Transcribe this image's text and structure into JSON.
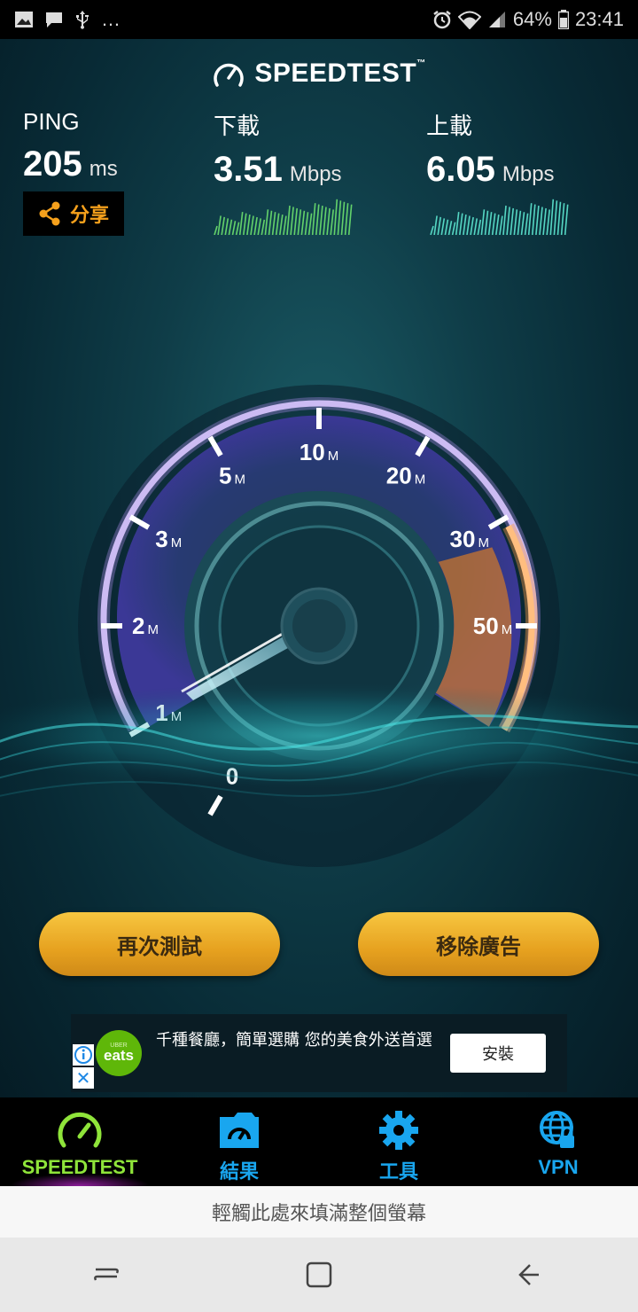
{
  "status_bar": {
    "battery": "64%",
    "time": "23:41",
    "more": "…"
  },
  "app": {
    "logo": "SPEEDTEST",
    "trademark": "™",
    "ping": {
      "label": "PING",
      "value": "205",
      "unit": "ms"
    },
    "download": {
      "label": "下載",
      "value": "3.51",
      "unit": "Mbps"
    },
    "upload": {
      "label": "上載",
      "value": "6.05",
      "unit": "Mbps"
    },
    "share_label": "分享",
    "gauge": {
      "ticks": [
        {
          "num": "0",
          "unit": ""
        },
        {
          "num": "1",
          "unit": "M"
        },
        {
          "num": "2",
          "unit": "M"
        },
        {
          "num": "3",
          "unit": "M"
        },
        {
          "num": "5",
          "unit": "M"
        },
        {
          "num": "10",
          "unit": "M"
        },
        {
          "num": "20",
          "unit": "M"
        },
        {
          "num": "30",
          "unit": "M"
        },
        {
          "num": "50",
          "unit": "M"
        }
      ]
    },
    "buttons": {
      "retest": "再次測試",
      "remove_ads": "移除廣告"
    }
  },
  "ad": {
    "brand_small": "UBER",
    "brand": "eats",
    "text": "千種餐廳，簡單選購 您的美食外送首選",
    "install": "安裝",
    "close": "✕"
  },
  "tabs": [
    {
      "label": "SPEEDTEST",
      "icon": "speedometer-icon",
      "active": true
    },
    {
      "label": "結果",
      "icon": "results-icon",
      "active": false
    },
    {
      "label": "工具",
      "icon": "gear-icon",
      "active": false
    },
    {
      "label": "VPN",
      "icon": "vpn-globe-lock-icon",
      "active": false
    }
  ],
  "fullscreen_hint": "輕觸此處來填滿整個螢幕",
  "colors": {
    "accent_green": "#8fe43a",
    "accent_blue": "#19a6ef",
    "share_orange": "#f6a11c",
    "button_gold": "#f0b530"
  }
}
